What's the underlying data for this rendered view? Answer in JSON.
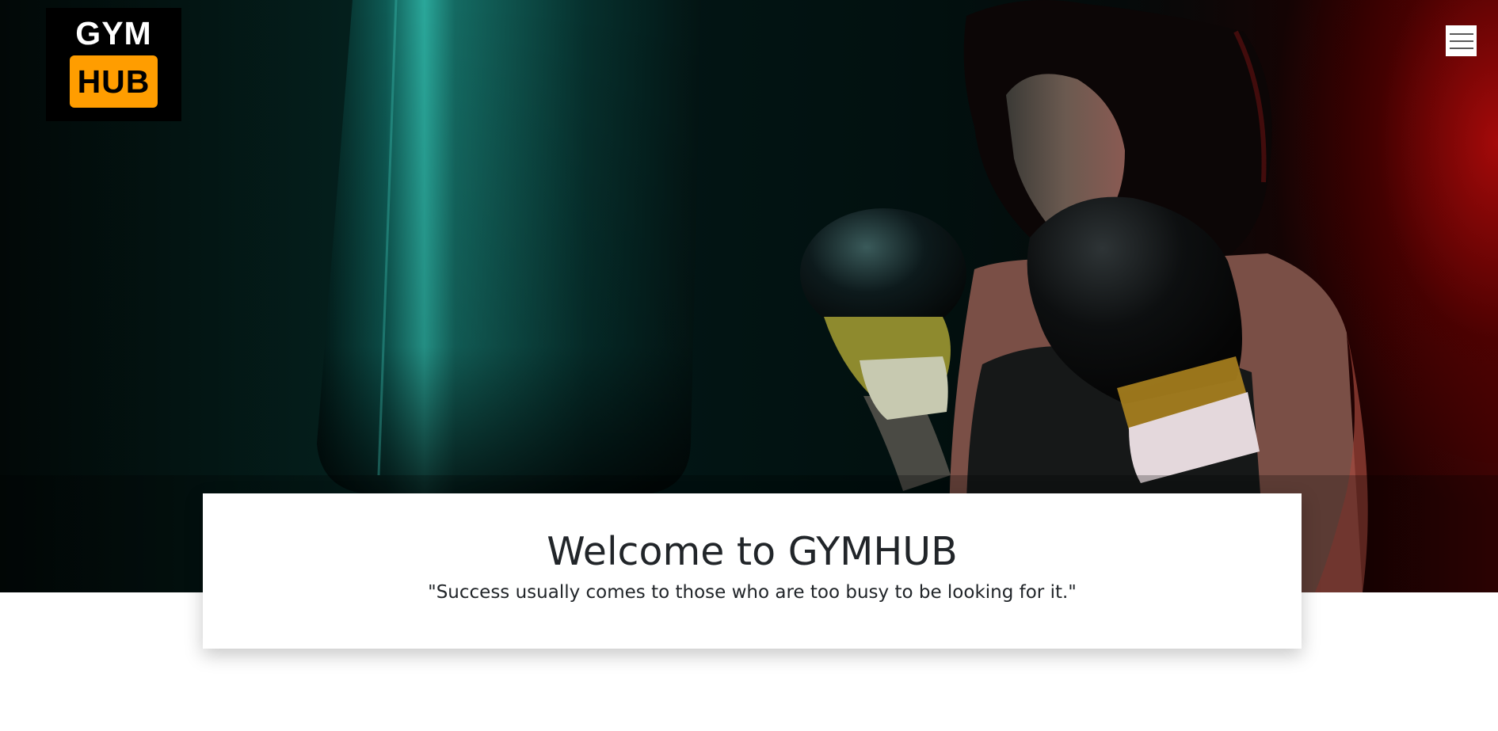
{
  "logo": {
    "line1": "GYM",
    "line2": "HUB",
    "accent_color": "#ff9d00"
  },
  "header": {
    "menu_icon": "hamburger-menu-icon"
  },
  "hero": {
    "image": "boxer-with-punching-bag"
  },
  "welcome": {
    "title": "Welcome to GYMHUB",
    "quote": "\"Success usually comes to those who are too busy to be looking for it.\""
  }
}
